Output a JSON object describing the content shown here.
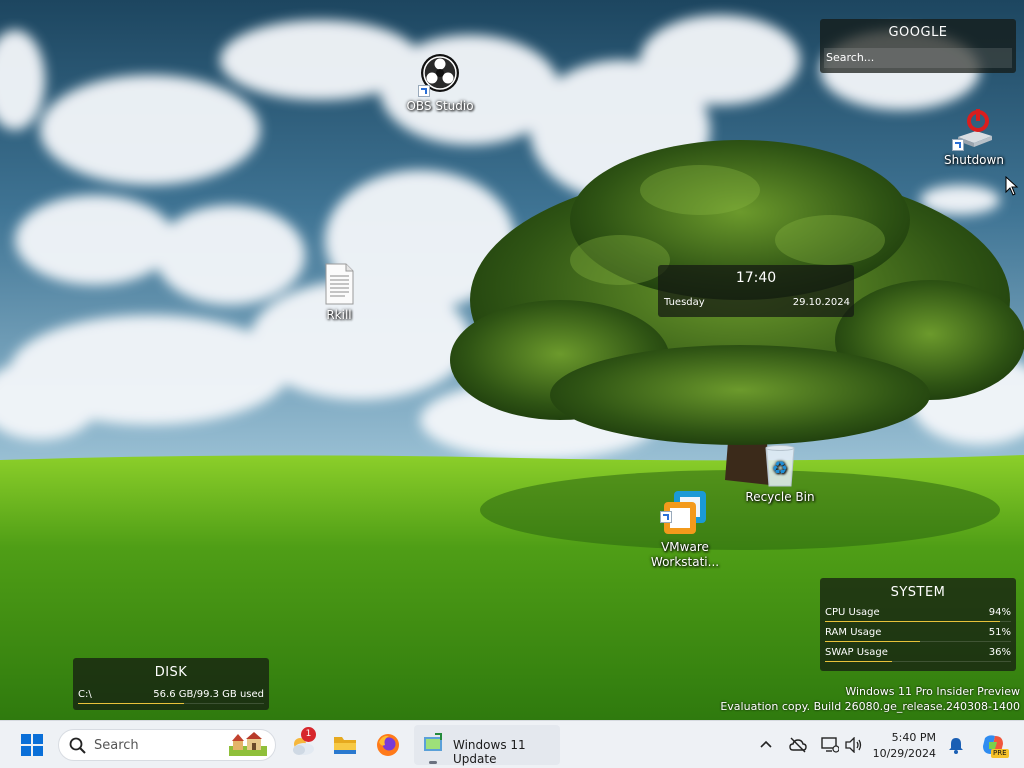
{
  "desktop": {
    "icons": [
      {
        "label": "OBS Studio",
        "icon": "obs-studio-icon"
      },
      {
        "label": "Shutdown",
        "icon": "shutdown-icon"
      },
      {
        "label": "Rkill",
        "icon": "text-file-icon"
      },
      {
        "label": "VMware\nWorkstati...",
        "icon": "vmware-workstation-icon"
      },
      {
        "label": "Recycle Bin",
        "icon": "recycle-bin-icon"
      }
    ]
  },
  "widgets": {
    "google": {
      "title": "GOOGLE",
      "placeholder": "Search..."
    },
    "clock": {
      "time": "17:40",
      "day": "Tuesday",
      "date": "29.10.2024"
    },
    "system": {
      "title": "SYSTEM",
      "rows": [
        {
          "label": "CPU Usage",
          "value": "94%",
          "percent": 94
        },
        {
          "label": "RAM Usage",
          "value": "51%",
          "percent": 51
        },
        {
          "label": "SWAP Usage",
          "value": "36%",
          "percent": 36
        }
      ]
    },
    "disk": {
      "title": "DISK",
      "drive": "C:\\",
      "usage": "56.6 GB/99.3 GB used",
      "fraction": 0.57
    }
  },
  "watermark": {
    "line1": "Windows 11 Pro Insider Preview",
    "line2": "Evaluation copy. Build 26080.ge_release.240308-1400"
  },
  "taskbar": {
    "search_label": "Search",
    "apps": [
      {
        "name": "widgets-weather",
        "badge": "1"
      },
      {
        "name": "file-explorer"
      },
      {
        "name": "firefox"
      },
      {
        "name": "windows-update",
        "label": "Windows 11 Update"
      }
    ],
    "tray": {
      "time": "5:40 PM",
      "date": "10/29/2024",
      "copilot_badge": "PRE"
    }
  },
  "colors": {
    "accent": "#0078d4",
    "widget_bar": "#e8c23a",
    "start_blue": "#0a6fd8"
  }
}
